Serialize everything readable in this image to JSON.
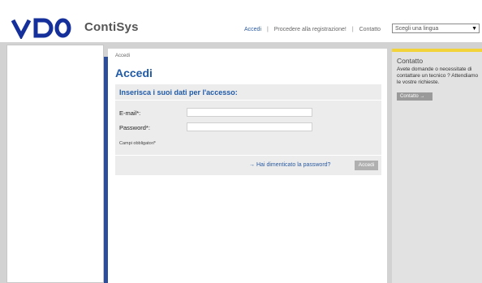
{
  "brand": {
    "logo_text": "VDO",
    "app_name": "ContiSys"
  },
  "topnav": {
    "login": "Accedi",
    "separator": "|",
    "register": "Procedere alla registrazione!",
    "contact": "Contatto",
    "language_placeholder": "Scegli una lingua",
    "language_arrow": "▼"
  },
  "main": {
    "breadcrumb": "Accedi",
    "title": "Accedi",
    "form": {
      "heading": "Inserisca i suoi dati per l'accesso:",
      "email_label": "E-mail*:",
      "email_value": "",
      "password_label": "Password*:",
      "password_value": "",
      "required_note": "Campi obbligatori*",
      "forgot_arrow": "→",
      "forgot_link": "Hai dimenticato la password?",
      "submit": "Accedi"
    }
  },
  "sidebar": {
    "title": "Contatto",
    "text": "Avete domande o necessitate di contattare un tecnico ? Attendiamo le vostre richieste.",
    "button": "Contatto",
    "button_arrow": "→"
  },
  "colors": {
    "accent_blue": "#1f5aa8",
    "strip_blue": "#2b4d9a",
    "highlight_yellow": "#f2d43a"
  }
}
